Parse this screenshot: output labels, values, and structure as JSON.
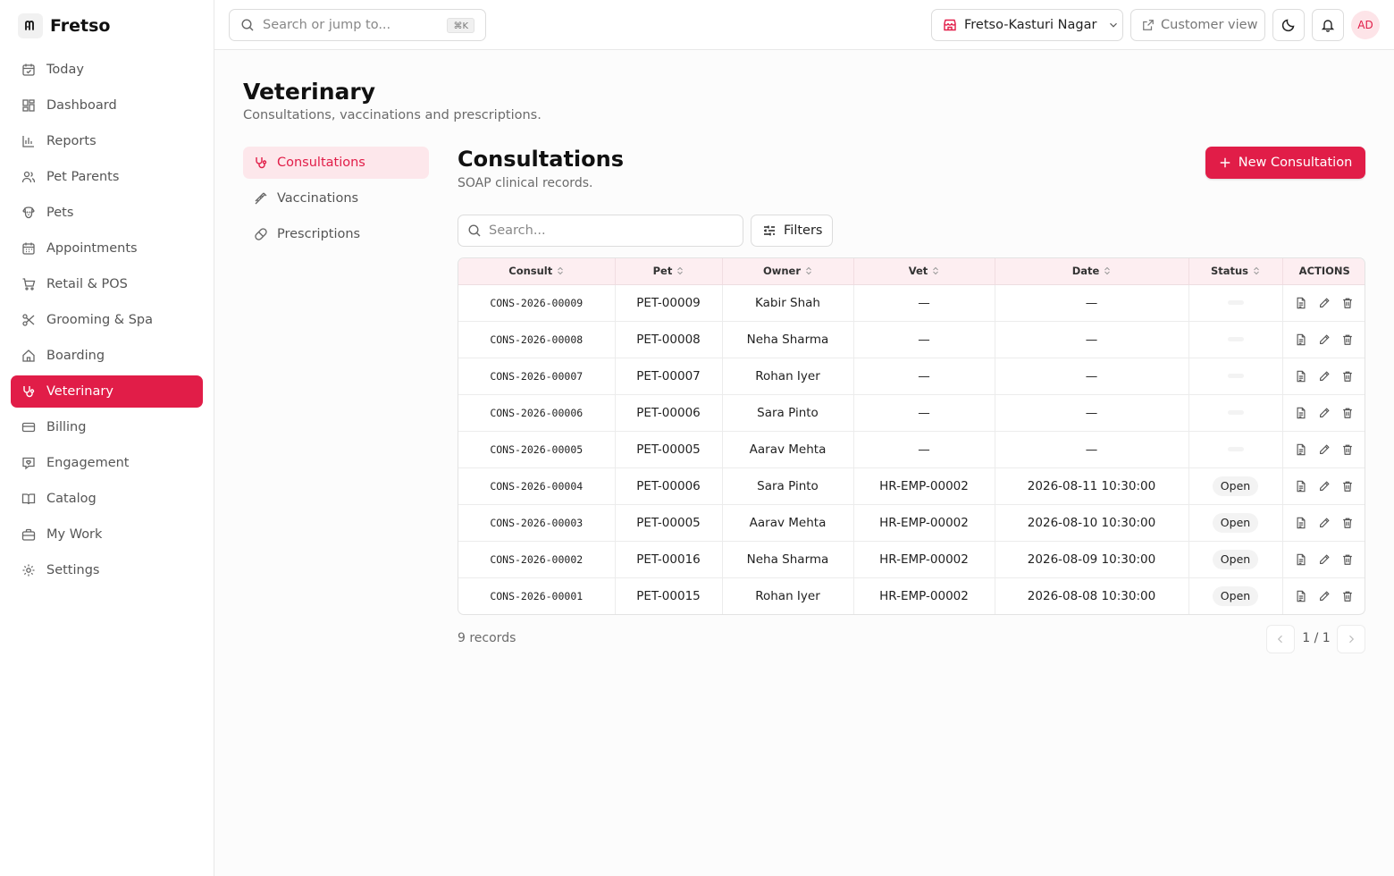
{
  "brand": {
    "name": "Fretso"
  },
  "sidebar": {
    "items": [
      {
        "label": "Today",
        "icon": "calendar-check-icon",
        "active": false
      },
      {
        "label": "Dashboard",
        "icon": "dashboard-icon",
        "active": false
      },
      {
        "label": "Reports",
        "icon": "bar-chart-icon",
        "active": false
      },
      {
        "label": "Pet Parents",
        "icon": "users-icon",
        "active": false
      },
      {
        "label": "Pets",
        "icon": "dog-icon",
        "active": false
      },
      {
        "label": "Appointments",
        "icon": "calendar-icon",
        "active": false
      },
      {
        "label": "Retail & POS",
        "icon": "cart-icon",
        "active": false
      },
      {
        "label": "Grooming & Spa",
        "icon": "scissors-icon",
        "active": false
      },
      {
        "label": "Boarding",
        "icon": "home-icon",
        "active": false
      },
      {
        "label": "Veterinary",
        "icon": "stethoscope-icon",
        "active": true
      },
      {
        "label": "Billing",
        "icon": "credit-card-icon",
        "active": false
      },
      {
        "label": "Engagement",
        "icon": "message-heart-icon",
        "active": false
      },
      {
        "label": "Catalog",
        "icon": "book-open-icon",
        "active": false
      },
      {
        "label": "My Work",
        "icon": "briefcase-icon",
        "active": false
      },
      {
        "label": "Settings",
        "icon": "gear-icon",
        "active": false
      }
    ]
  },
  "topbar": {
    "search_placeholder": "Search or jump to...",
    "shortcut": "⌘K",
    "store": "Fretso-Kasturi Nagar",
    "customer_view": "Customer view",
    "avatar_initials": "AD"
  },
  "page": {
    "title": "Veterinary",
    "subtitle": "Consultations, vaccinations and prescriptions."
  },
  "subnav": {
    "items": [
      {
        "label": "Consultations",
        "icon": "stethoscope-icon",
        "active": true
      },
      {
        "label": "Vaccinations",
        "icon": "syringe-icon",
        "active": false
      },
      {
        "label": "Prescriptions",
        "icon": "pill-icon",
        "active": false
      }
    ]
  },
  "section": {
    "title": "Consultations",
    "subtitle": "SOAP clinical records.",
    "new_button": "New Consultation"
  },
  "table_controls": {
    "search_placeholder": "Search...",
    "filters_label": "Filters"
  },
  "table": {
    "columns": [
      {
        "label": "Consult",
        "sortable": true
      },
      {
        "label": "Pet",
        "sortable": true
      },
      {
        "label": "Owner",
        "sortable": true
      },
      {
        "label": "Vet",
        "sortable": true
      },
      {
        "label": "Date",
        "sortable": true
      },
      {
        "label": "Status",
        "sortable": true
      },
      {
        "label": "ACTIONS",
        "sortable": false
      }
    ],
    "rows": [
      {
        "consult": "CONS-2026-00009",
        "pet": "PET-00009",
        "owner": "Kabir Shah",
        "vet": "—",
        "date": "—",
        "status": ""
      },
      {
        "consult": "CONS-2026-00008",
        "pet": "PET-00008",
        "owner": "Neha Sharma",
        "vet": "—",
        "date": "—",
        "status": ""
      },
      {
        "consult": "CONS-2026-00007",
        "pet": "PET-00007",
        "owner": "Rohan Iyer",
        "vet": "—",
        "date": "—",
        "status": ""
      },
      {
        "consult": "CONS-2026-00006",
        "pet": "PET-00006",
        "owner": "Sara Pinto",
        "vet": "—",
        "date": "—",
        "status": ""
      },
      {
        "consult": "CONS-2026-00005",
        "pet": "PET-00005",
        "owner": "Aarav Mehta",
        "vet": "—",
        "date": "—",
        "status": ""
      },
      {
        "consult": "CONS-2026-00004",
        "pet": "PET-00006",
        "owner": "Sara Pinto",
        "vet": "HR-EMP-00002",
        "date": "2026-08-11 10:30:00",
        "status": "Open"
      },
      {
        "consult": "CONS-2026-00003",
        "pet": "PET-00005",
        "owner": "Aarav Mehta",
        "vet": "HR-EMP-00002",
        "date": "2026-08-10 10:30:00",
        "status": "Open"
      },
      {
        "consult": "CONS-2026-00002",
        "pet": "PET-00016",
        "owner": "Neha Sharma",
        "vet": "HR-EMP-00002",
        "date": "2026-08-09 10:30:00",
        "status": "Open"
      },
      {
        "consult": "CONS-2026-00001",
        "pet": "PET-00015",
        "owner": "Rohan Iyer",
        "vet": "HR-EMP-00002",
        "date": "2026-08-08 10:30:00",
        "status": "Open"
      }
    ]
  },
  "footer": {
    "record_count": "9 records",
    "page_label": "1 / 1"
  },
  "colors": {
    "accent": "#e11d48",
    "accent_soft": "#fde7eb",
    "header_row_bg": "#fdeef1"
  }
}
